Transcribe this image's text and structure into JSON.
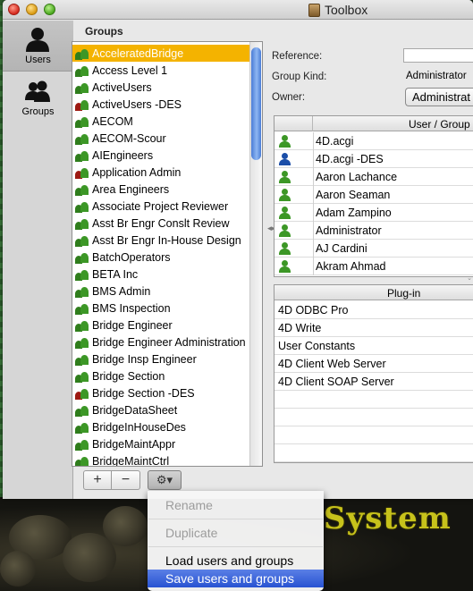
{
  "window": {
    "title": "Toolbox"
  },
  "sidebar": {
    "items": [
      {
        "label": "Users",
        "icon": "user-icon",
        "selected": true
      },
      {
        "label": "Groups",
        "icon": "group-icon",
        "selected": false
      }
    ]
  },
  "groups": {
    "header": "Groups",
    "items": [
      {
        "label": "AcceleratedBridge",
        "icon": "green",
        "selected": true
      },
      {
        "label": "Access Level 1",
        "icon": "green"
      },
      {
        "label": "ActiveUsers",
        "icon": "green"
      },
      {
        "label": "ActiveUsers -DES",
        "icon": "red"
      },
      {
        "label": "AECOM",
        "icon": "green"
      },
      {
        "label": "AECOM-Scour",
        "icon": "green"
      },
      {
        "label": "AIEngineers",
        "icon": "green"
      },
      {
        "label": "Application Admin",
        "icon": "red"
      },
      {
        "label": "Area Engineers",
        "icon": "green"
      },
      {
        "label": "Associate Project Reviewer",
        "icon": "green"
      },
      {
        "label": "Asst Br Engr Conslt Review",
        "icon": "green"
      },
      {
        "label": "Asst Br Engr In-House Design",
        "icon": "green"
      },
      {
        "label": "BatchOperators",
        "icon": "green"
      },
      {
        "label": "BETA Inc",
        "icon": "green"
      },
      {
        "label": "BMS Admin",
        "icon": "green"
      },
      {
        "label": "BMS Inspection",
        "icon": "green"
      },
      {
        "label": "Bridge Engineer",
        "icon": "green"
      },
      {
        "label": "Bridge Engineer Administration",
        "icon": "green"
      },
      {
        "label": "Bridge Insp Engineer",
        "icon": "green"
      },
      {
        "label": "Bridge Section",
        "icon": "green"
      },
      {
        "label": "Bridge Section -DES",
        "icon": "red"
      },
      {
        "label": "BridgeDataSheet",
        "icon": "green"
      },
      {
        "label": "BridgeInHouseDes",
        "icon": "green"
      },
      {
        "label": "BridgeMaintAppr",
        "icon": "green"
      },
      {
        "label": "BridgeMaintCtrl",
        "icon": "green"
      }
    ],
    "add_label": "+",
    "remove_label": "−",
    "gear_label": "⚙▾"
  },
  "detail": {
    "reference_label": "Reference:",
    "reference_value": "",
    "group_kind_label": "Group Kind:",
    "group_kind_value": "Administrator",
    "owner_label": "Owner:",
    "owner_value": "Administrat"
  },
  "user_table": {
    "header": "User / Group",
    "rows": [
      {
        "name": "4D.acgi",
        "icon": "green"
      },
      {
        "name": "4D.acgi -DES",
        "icon": "blue"
      },
      {
        "name": "Aaron Lachance",
        "icon": "green"
      },
      {
        "name": "Aaron Seaman",
        "icon": "green"
      },
      {
        "name": "Adam Zampino",
        "icon": "green"
      },
      {
        "name": "Administrator",
        "icon": "green"
      },
      {
        "name": "AJ Cardini",
        "icon": "green"
      },
      {
        "name": "Akram Ahmad",
        "icon": "green"
      }
    ]
  },
  "plugin_table": {
    "header": "Plug-in",
    "rows": [
      "4D ODBC Pro",
      "4D Write",
      "User Constants",
      "4D Client Web Server",
      "4D Client SOAP Server"
    ]
  },
  "gear_menu": {
    "items": [
      {
        "label": "Rename",
        "enabled": false
      },
      {
        "label": "Duplicate",
        "enabled": false
      },
      {
        "label": "Load users and groups",
        "enabled": true
      },
      {
        "label": "Save users and groups",
        "enabled": true,
        "highlighted": true
      }
    ]
  },
  "background": {
    "banner_text": "System"
  },
  "colors": {
    "selection": "#f4b300",
    "menu_highlight": "#2853d2",
    "scroll_thumb": "#4a7cd6"
  }
}
